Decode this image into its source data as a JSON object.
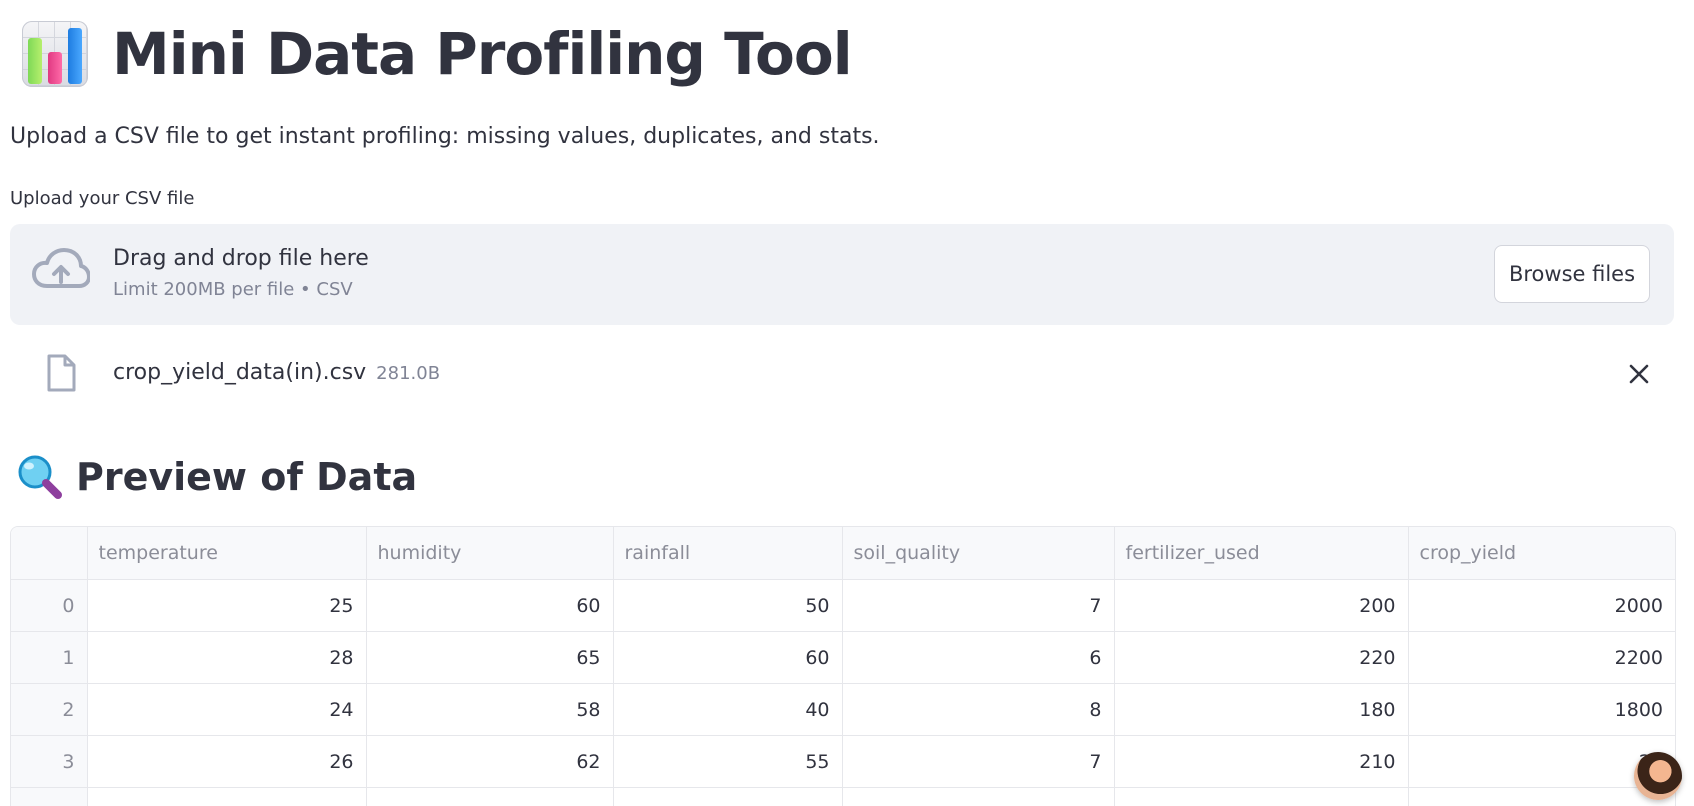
{
  "app": {
    "title": "Mini Data Profiling Tool",
    "title_icon": "bar-chart-icon",
    "subtitle": "Upload a CSV file to get instant profiling: missing values, duplicates, and stats."
  },
  "uploader": {
    "label": "Upload your CSV file",
    "drop_text": "Drag and drop file here",
    "limit_text": "Limit 200MB per file • CSV",
    "browse_label": "Browse files",
    "icons": {
      "drop": "cloud-upload-icon",
      "file": "file-icon",
      "remove": "close-icon"
    }
  },
  "uploaded_file": {
    "name": "crop_yield_data(in).csv",
    "size": "281.0B"
  },
  "preview": {
    "title": "Preview of Data",
    "title_icon": "magnifier-icon",
    "columns": [
      "",
      "temperature",
      "humidity",
      "rainfall",
      "soil_quality",
      "fertilizer_used",
      "crop_yield"
    ],
    "rows": [
      [
        "0",
        "25",
        "60",
        "50",
        "7",
        "200",
        "2000"
      ],
      [
        "1",
        "28",
        "65",
        "60",
        "6",
        "220",
        "2200"
      ],
      [
        "2",
        "24",
        "58",
        "40",
        "8",
        "180",
        "1800"
      ],
      [
        "3",
        "26",
        "62",
        "55",
        "7",
        "210",
        "21"
      ]
    ]
  },
  "colors": {
    "text": "#31333f",
    "muted": "#808495",
    "dropzone_bg": "#f0f2f6",
    "header_bg": "#f8f9fb",
    "border": "#e6e7eb"
  }
}
